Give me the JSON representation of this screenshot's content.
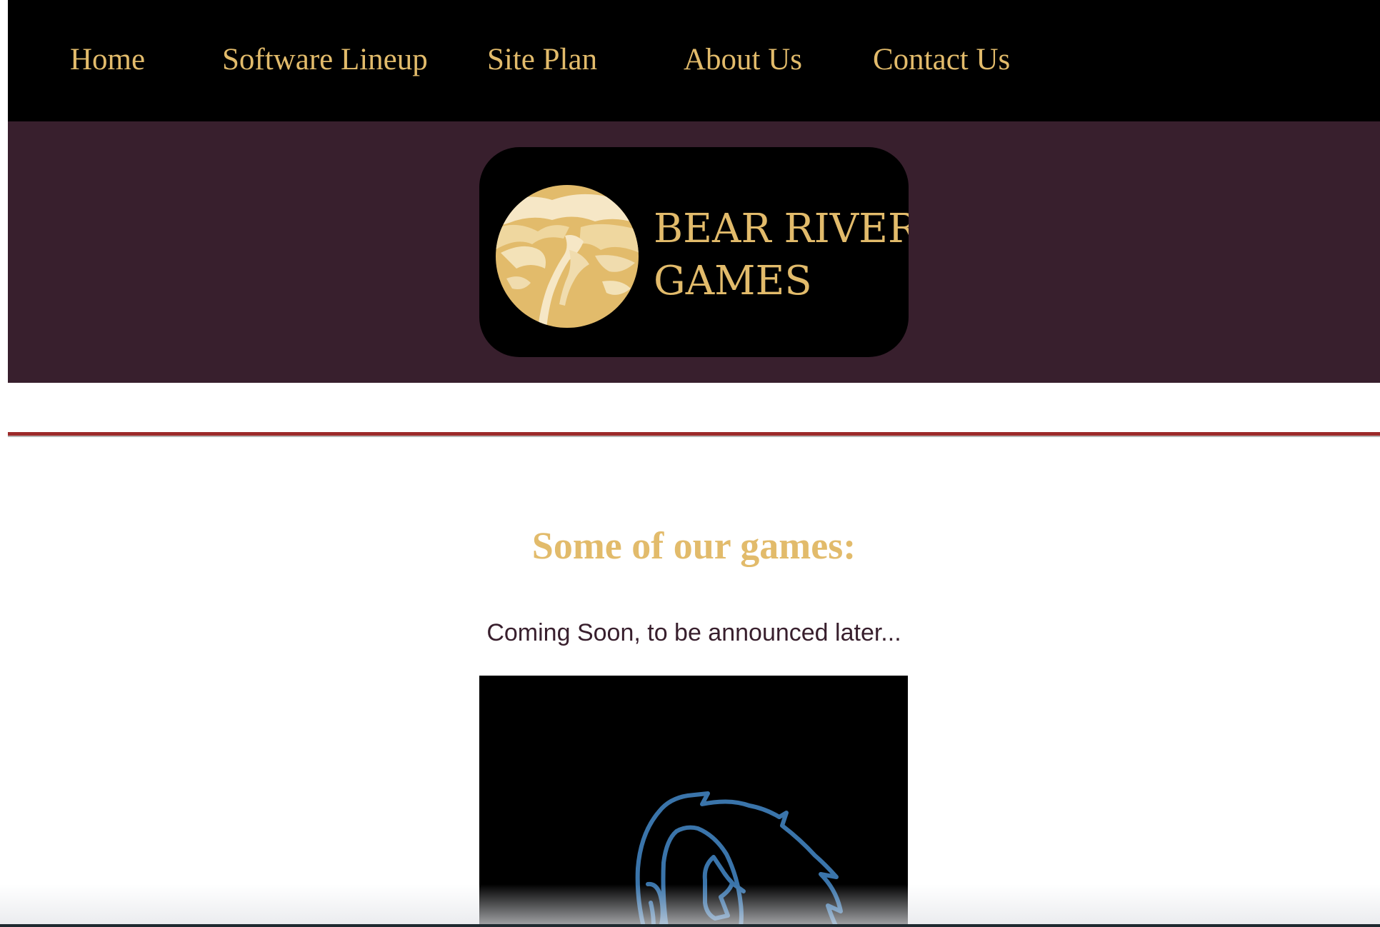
{
  "nav": {
    "links": [
      {
        "label": "Home"
      },
      {
        "label": "Software Lineup"
      },
      {
        "label": "Site Plan"
      },
      {
        "label": "About Us"
      },
      {
        "label": "Contact Us"
      }
    ]
  },
  "logo": {
    "line1": "BEAR RIVER",
    "line2": "GAMES",
    "emblem_icon": "mountain-valley-moon-icon"
  },
  "main": {
    "title": "Some of our games:",
    "subtitle": "Coming Soon, to be announced later...",
    "game_art_icon": "blue-bear-outline-icon"
  },
  "colors": {
    "nav_background": "#000000",
    "accent_gold": "#e2bb6b",
    "hero_background": "#381f2d",
    "divider_red": "#9c2a2a",
    "text_plum": "#381f2d",
    "art_blue": "#3a74aa"
  }
}
